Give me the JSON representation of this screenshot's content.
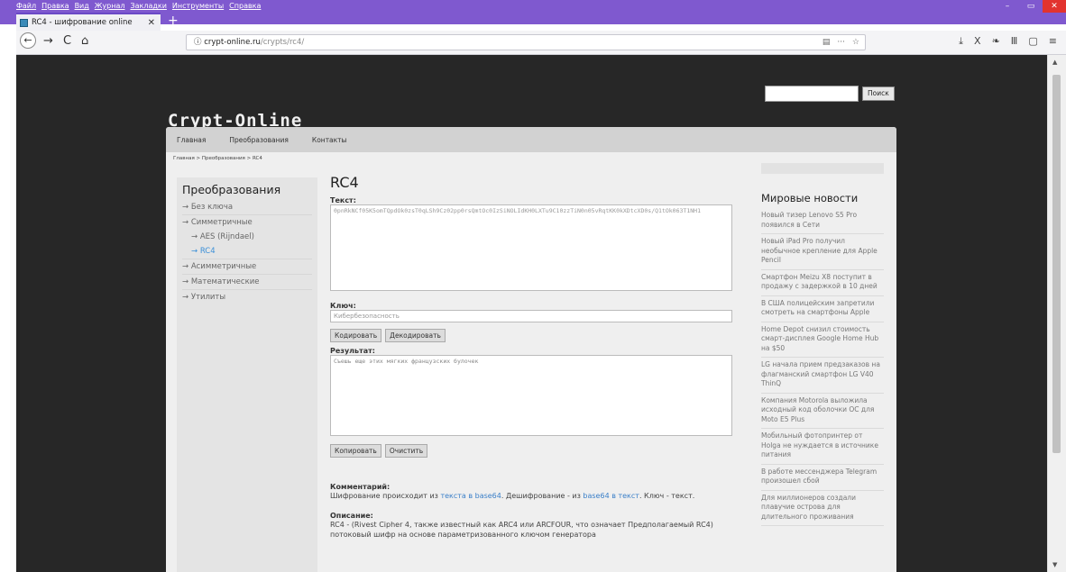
{
  "window": {
    "menu": [
      "Файл",
      "Правка",
      "Вид",
      "Журнал",
      "Закладки",
      "Инструменты",
      "Справка"
    ],
    "controls": [
      "–",
      "▭",
      "✕"
    ]
  },
  "tab": {
    "title": "RC4 - шифрование online",
    "close": "✕",
    "new": "+"
  },
  "toolbar": {
    "back": "←",
    "forward": "→",
    "reload": "C",
    "home": "⌂",
    "url_host": "crypt-online.ru",
    "url_path": "/crypts/rc4/",
    "url_info": "ⓘ",
    "url_right": [
      "▤",
      "···",
      "☆"
    ],
    "icons": [
      "⤓",
      "X",
      "❧",
      "Ⅲ",
      "▢",
      "≡"
    ]
  },
  "site": {
    "logo": "Crypt-Online",
    "search_button": "Поиск",
    "nav": [
      "Главная",
      "Преобразования",
      "Контакты"
    ],
    "breadcrumb": "Главная > Преобразования > RC4"
  },
  "sidebar": {
    "title": "Преобразования",
    "items": [
      {
        "label": "→ Без ключа",
        "sub": false,
        "active": false
      },
      {
        "label": "→ Симметричные",
        "sub": false,
        "active": false
      },
      {
        "label": "→ AES (Rijndael)",
        "sub": true,
        "active": false
      },
      {
        "label": "→ RC4",
        "sub": true,
        "active": true
      },
      {
        "label": "→ Асимметричные",
        "sub": false,
        "active": false
      },
      {
        "label": "→ Математические",
        "sub": false,
        "active": false
      },
      {
        "label": "→ Утилиты",
        "sub": false,
        "active": false
      }
    ]
  },
  "main": {
    "title": "RC4",
    "text_label": "Текст:",
    "text_value": "0pnRkNCf05K5omTQpdOk0zsT0qLSh9Cz02pp0rsQmtOc0IzSiNOLIdKH0LXTu9C10zzTiN0n05vRqtKK0kXDtcXD0s/Q1tOk063T1NH1",
    "key_label": "Ключ:",
    "key_value": "Кибербезопасность",
    "encode_button": "Кодировать",
    "decode_button": "Декодировать",
    "result_label": "Результат:",
    "result_value": "Съешь еще этих мягких французских булочек",
    "copy_button": "Копировать",
    "clear_button": "Очистить",
    "comment_label": "Комментарий:",
    "comment_pre": "Шифрование происходит из ",
    "comment_link1": "текста в base64",
    "comment_mid": ". Дешифрование - из ",
    "comment_link2": "base64 в текст",
    "comment_post": ". Ключ - текст.",
    "desc_label": "Описание:",
    "desc_text": "RC4 - (Rivest Cipher 4, также известный как ARC4 или ARCFOUR, что означает Предполагаемый RC4) потоковый шифр на основе параметризованного ключом генератора"
  },
  "news": {
    "title": "Мировые новости",
    "items": [
      "Новый тизер Lenovo S5 Pro появился в Сети",
      "Новый iPad Pro получил необычное крепление для Apple Pencil",
      "Смартфон Meizu X8 поступит в продажу с задержкой в 10 дней",
      "В США полицейским запретили смотреть на смартфоны Apple",
      "Home Depot снизил стоимость смарт-дисплея Google Home Hub на $50",
      "LG начала прием предзаказов на флагманский смартфон LG V40 ThinQ",
      "Компания Motorola выложила исходный код оболочки ОС для Moto E5 Plus",
      "Мобильный фотопринтер от Holga не нуждается в источнике питания",
      "В работе мессенджера Telegram произошел сбой",
      "Для миллионеров создали плавучие острова для длительного проживания"
    ]
  }
}
